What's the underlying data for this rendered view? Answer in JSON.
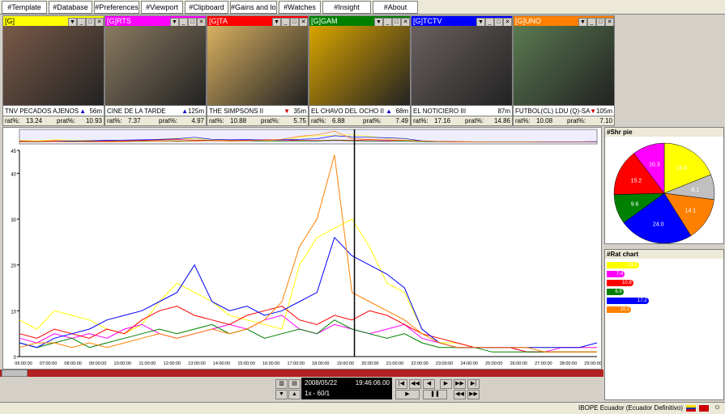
{
  "menu": [
    "#Template",
    "#Database",
    "#Preferences",
    "#Viewport",
    "#Clipboard",
    "#Gains and losses",
    "#Watches",
    "#Insight",
    "#About"
  ],
  "channels": [
    {
      "name": "[G]",
      "color": "#ffff00",
      "title_color": "#000000",
      "stamp": "",
      "program": "TNV PECADOS AJENOS",
      "dir": "up",
      "dur": "56m",
      "rat": "13.24",
      "prat": "10.93",
      "video": "#7a5a48"
    },
    {
      "name": "[G]RTS",
      "color": "#ff00ff",
      "title_color": "#ffffff",
      "stamp": "",
      "program": "CINE DE LA TARDE",
      "dir": "up",
      "dur": "125m",
      "rat": "7.37",
      "prat": "4.97",
      "video": "#8a7a60"
    },
    {
      "name": "[G]TA",
      "color": "#ff0000",
      "title_color": "#ffffff",
      "stamp": "",
      "program": "THE SIMPSONS II",
      "dir": "down",
      "dur": "35m",
      "rat": "10.88",
      "prat": "5.75",
      "video": "#d8b060"
    },
    {
      "name": "[G]GAM",
      "color": "#008000",
      "title_color": "#ffffff",
      "stamp": "",
      "program": "EL CHAVO DEL OCHO II",
      "dir": "up",
      "dur": "68m",
      "rat": "6.88",
      "prat": "7.49",
      "video": "#d9a400"
    },
    {
      "name": "[G]TCTV",
      "color": "#0000ff",
      "title_color": "#ffffff",
      "stamp": "",
      "program": "EL NOTICIERO III",
      "dir": "",
      "dur": "87m",
      "rat": "17.16",
      "prat": "14.86",
      "video": "#6a6060"
    },
    {
      "name": "[G]UNO",
      "color": "#ff8000",
      "title_color": "#ffffff",
      "stamp": "",
      "program": "FUTBOL(CL) LDU (Q)-SA",
      "dir": "down",
      "dur": "105m",
      "rat": "10.08",
      "prat": "7.10",
      "video": "#5a7a50"
    }
  ],
  "labels": {
    "rat": "rat%:",
    "prat": "prat%:"
  },
  "chart_data": {
    "type": "line",
    "x_ticks": [
      "06:00:00",
      "07:00:00",
      "08:00:00",
      "09:00:00",
      "10:00:00",
      "11:00:00",
      "12:00:00",
      "13:00:00",
      "14:00:00",
      "15:00:00",
      "16:00:00",
      "17:00:00",
      "18:00:00",
      "19:00:00",
      "20:00:00",
      "21:00:00",
      "22:00:00",
      "23:00:00",
      "24:00:00",
      "25:00:00",
      "26:00:00",
      "27:00:00",
      "28:00:00",
      "29:00:00"
    ],
    "y_ticks": [
      "0",
      "10",
      "20",
      "30",
      "40",
      "45"
    ],
    "ylim": [
      0,
      45
    ],
    "cursor_time": "19:46:06",
    "series": [
      {
        "color": "#ffff00",
        "values": [
          8,
          6,
          10,
          9,
          8,
          6,
          5,
          7,
          12,
          16,
          14,
          12,
          9,
          8,
          7,
          6,
          20,
          26,
          28,
          30,
          24,
          16,
          14,
          6,
          3,
          3,
          2,
          2,
          2,
          2,
          2,
          2,
          2,
          2
        ]
      },
      {
        "color": "#ff00ff",
        "values": [
          4,
          3,
          5,
          4,
          5,
          4,
          6,
          7,
          5,
          4,
          5,
          6,
          7,
          6,
          8,
          9,
          6,
          5,
          7,
          6,
          5,
          6,
          7,
          4,
          3,
          2,
          2,
          2,
          2,
          1,
          1,
          2,
          2,
          2
        ]
      },
      {
        "color": "#ff0000",
        "values": [
          5,
          4,
          6,
          5,
          4,
          6,
          5,
          8,
          10,
          11,
          9,
          8,
          7,
          9,
          10,
          11,
          8,
          7,
          9,
          8,
          10,
          9,
          7,
          5,
          4,
          3,
          2,
          2,
          2,
          1,
          1,
          1,
          1,
          1
        ]
      },
      {
        "color": "#008000",
        "values": [
          3,
          2,
          3,
          4,
          2,
          3,
          4,
          5,
          6,
          5,
          6,
          7,
          5,
          6,
          4,
          5,
          6,
          5,
          8,
          6,
          5,
          4,
          5,
          3,
          2,
          2,
          2,
          1,
          1,
          1,
          1,
          1,
          1,
          1
        ]
      },
      {
        "color": "#0000ff",
        "values": [
          3,
          2,
          4,
          5,
          6,
          8,
          9,
          10,
          12,
          14,
          20,
          12,
          10,
          11,
          9,
          10,
          12,
          14,
          26,
          22,
          20,
          18,
          15,
          6,
          3,
          2,
          2,
          2,
          2,
          2,
          2,
          2,
          2,
          3
        ]
      },
      {
        "color": "#ff8000",
        "values": [
          2,
          3,
          3,
          2,
          3,
          2,
          3,
          4,
          5,
          4,
          5,
          6,
          5,
          6,
          8,
          12,
          24,
          30,
          44,
          14,
          12,
          10,
          8,
          5,
          3,
          2,
          2,
          2,
          2,
          2,
          1,
          1,
          1,
          1
        ]
      }
    ]
  },
  "pie": {
    "title": "#Shr pie",
    "slices": [
      {
        "value": 19.0,
        "color": "#ffff00",
        "label": "19.0"
      },
      {
        "value": 8.1,
        "color": "#c0c0c0",
        "label": "8.1"
      },
      {
        "value": 14.1,
        "color": "#ff8000",
        "label": "14.1"
      },
      {
        "value": 24.0,
        "color": "#0000ff",
        "label": "24.0"
      },
      {
        "value": 9.6,
        "color": "#008000",
        "label": "9.6"
      },
      {
        "value": 15.2,
        "color": "#ff0000",
        "label": "15.2"
      },
      {
        "value": 10.3,
        "color": "#ff00ff",
        "label": "10.3"
      }
    ]
  },
  "rat_chart": {
    "title": "#Rat chart",
    "bars": [
      {
        "value": 13.2,
        "color": "#ffff00",
        "label": "13.2"
      },
      {
        "value": 7.4,
        "color": "#ff00ff",
        "label": "7.4"
      },
      {
        "value": 10.9,
        "color": "#ff0000",
        "label": "10.9"
      },
      {
        "value": 6.9,
        "color": "#008000",
        "label": "6.9"
      },
      {
        "value": 17.2,
        "color": "#0000ff",
        "label": "17.2"
      },
      {
        "value": 10.1,
        "color": "#ff8000",
        "label": "10.1"
      }
    ]
  },
  "player": {
    "date": "2008/05/22",
    "time": "19:46:06.00",
    "speed": "1x - 60/1"
  },
  "status": {
    "text": "IBOPE Ecuador (Ecuador Definitivo)"
  }
}
